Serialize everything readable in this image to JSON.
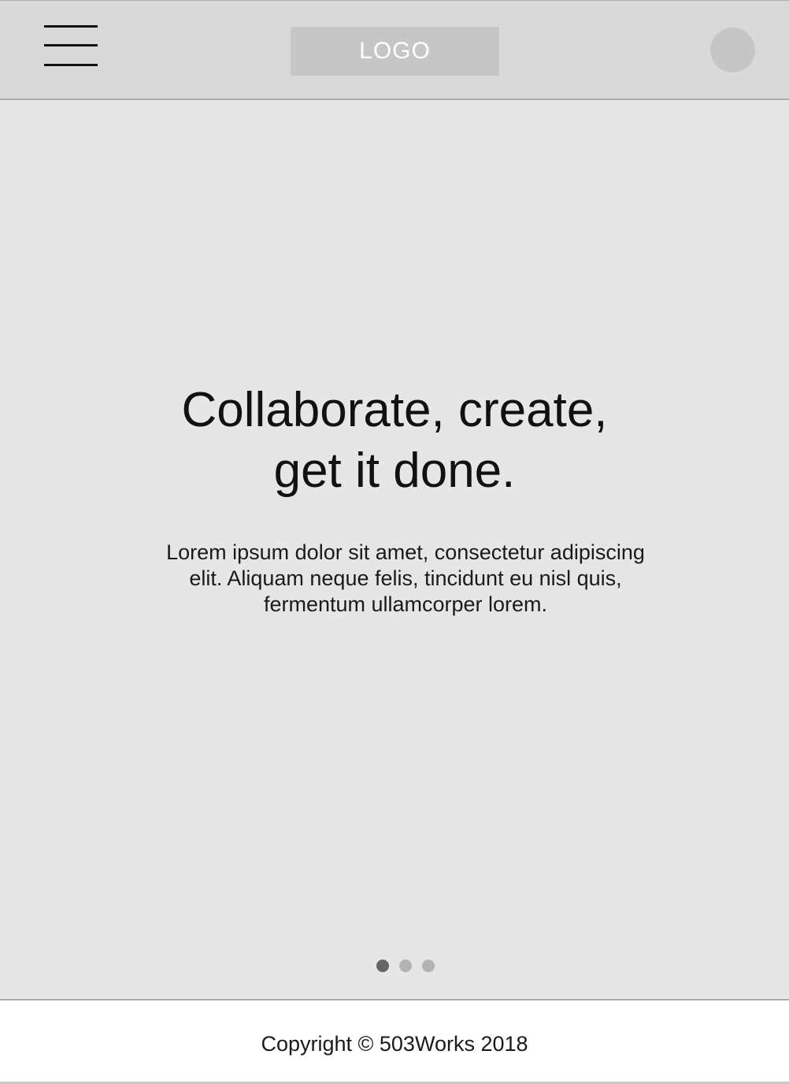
{
  "header": {
    "logo_text": "LOGO"
  },
  "hero": {
    "title_line1": "Collaborate, create,",
    "title_line2": "get it done.",
    "text_line1": "Lorem ipsum dolor sit amet, consectetur adipiscing",
    "text_line2": "elit. Aliquam neque felis, tincidunt eu nisl quis,",
    "text_line3": "fermentum ullamcorper lorem."
  },
  "carousel": {
    "slide_count": 3,
    "active_index": 0,
    "active_color": "#666666",
    "inactive_color": "#b3b3b3"
  },
  "footer": {
    "copyright": "Copyright © 503Works 2018"
  },
  "icons": {
    "menu": "hamburger-menu-icon",
    "avatar": "user-avatar-circle"
  },
  "colors": {
    "header_bg": "#d9d9d9",
    "placeholder": "#c6c6c6",
    "hero_bg": "#e6e6e6",
    "footer_bg": "#ffffff"
  }
}
